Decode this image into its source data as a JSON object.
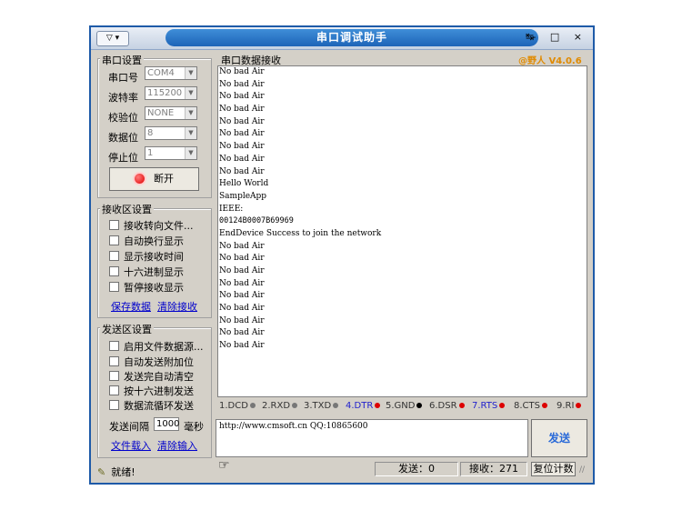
{
  "window": {
    "title": "串口调试助手",
    "sysmenu": "▽ ▾",
    "controls": "- □ ×",
    "version": "@野人 V4.0.6"
  },
  "serial": {
    "group": "串口设置",
    "port_label": "串口号",
    "port_value": "COM4",
    "baud_label": "波特率",
    "baud_value": "115200",
    "parity_label": "校验位",
    "parity_value": "NONE",
    "data_label": "数据位",
    "data_value": "8",
    "stop_label": "停止位",
    "stop_value": "1",
    "open_button": "断开"
  },
  "receive_settings": {
    "group": "接收区设置",
    "options": [
      "接收转向文件...",
      "自动换行显示",
      "显示接收时间",
      "十六进制显示",
      "暂停接收显示"
    ],
    "save_link": "保存数据",
    "clear_link": "清除接收"
  },
  "send_settings": {
    "group": "发送区设置",
    "options": [
      "启用文件数据源...",
      "自动发送附加位",
      "发送完自动清空",
      "按十六进制发送",
      "数据流循环发送"
    ],
    "interval_label": "发送间隔",
    "interval_value": "1000",
    "interval_unit": "毫秒",
    "load_link": "文件载入",
    "clear_link": "清除输入"
  },
  "receive": {
    "group": "串口数据接收",
    "lines": [
      "No bad Air",
      "No bad Air",
      "No bad Air",
      "No bad Air",
      "No bad Air",
      "No bad Air",
      "No bad Air",
      "No bad Air",
      "No bad Air",
      "Hello World",
      "SampleApp",
      "IEEE:",
      "00124B0007B69969",
      "EndDevice Success to join the network",
      "No bad Air",
      "No bad Air",
      "No bad Air",
      "No bad Air",
      "No bad Air",
      "No bad Air",
      "No bad Air",
      "No bad Air",
      "No bad Air"
    ]
  },
  "signals": [
    {
      "label": "1.DCD",
      "dot": "#777777"
    },
    {
      "label": "2.RXD",
      "dot": "#777777"
    },
    {
      "label": "3.TXD",
      "dot": "#777777"
    },
    {
      "label": "4.DTR",
      "dot": "#dd0000"
    },
    {
      "label": "5.GND",
      "dot": "#000000"
    },
    {
      "label": "6.DSR",
      "dot": "#dd0000"
    },
    {
      "label": "7.RTS",
      "dot": "#dd0000"
    },
    {
      "label": "8.CTS",
      "dot": "#dd0000"
    },
    {
      "label": "9.RI",
      "dot": "#dd0000"
    }
  ],
  "send": {
    "text": "http://www.cmsoft.cn QQ:10865600",
    "button": "发送"
  },
  "status": {
    "ready": "就绪!",
    "sent": "发送：0",
    "received": "接收：271",
    "reset": "复位计数"
  }
}
